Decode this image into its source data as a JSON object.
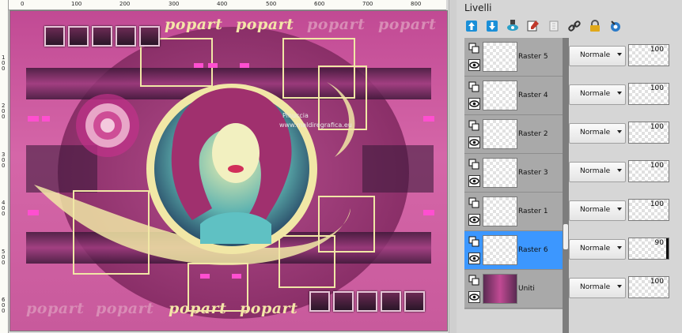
{
  "ruler": {
    "horizontal": [
      "0",
      "100",
      "200",
      "300",
      "400",
      "500",
      "600",
      "700",
      "800"
    ],
    "vertical": [
      "1\n0\n0",
      "2\n0\n0",
      "3\n0\n0",
      "4\n0\n0",
      "5\n0\n0",
      "6\n0\n0"
    ]
  },
  "canvas": {
    "top_texts": [
      "popart",
      "popart",
      "popart",
      "popart"
    ],
    "bottom_texts": [
      "popart",
      "popart",
      "popart",
      "popart"
    ],
    "watermark_line1": "Pinuccia",
    "watermark_line2": "www.maldiregrafica.eu"
  },
  "panel": {
    "title": "Livelli",
    "toolbar_icons": [
      "new-raster-layer-icon",
      "merge-down-icon",
      "new-mask-icon",
      "layer-properties-icon",
      "delete-layer-icon",
      "link-layers-icon",
      "lock-icon",
      "adjust-layer-icon"
    ],
    "layers": [
      {
        "name": "Raster 5",
        "blend": "Normale",
        "opacity": "100",
        "selected": false
      },
      {
        "name": "Raster 4",
        "blend": "Normale",
        "opacity": "100",
        "selected": false
      },
      {
        "name": "Raster 2",
        "blend": "Normale",
        "opacity": "100",
        "selected": false
      },
      {
        "name": "Raster 3",
        "blend": "Normale",
        "opacity": "100",
        "selected": false
      },
      {
        "name": "Raster 1",
        "blend": "Normale",
        "opacity": "100",
        "selected": false
      },
      {
        "name": "Raster 6",
        "blend": "Normale",
        "opacity": "90",
        "selected": true
      },
      {
        "name": "Uniti",
        "blend": "Normale",
        "opacity": "100",
        "selected": false
      }
    ]
  },
  "colors": {
    "selection": "#3c97ff",
    "canvas_pink": "#c14a94",
    "cream": "#f4e6a8"
  }
}
